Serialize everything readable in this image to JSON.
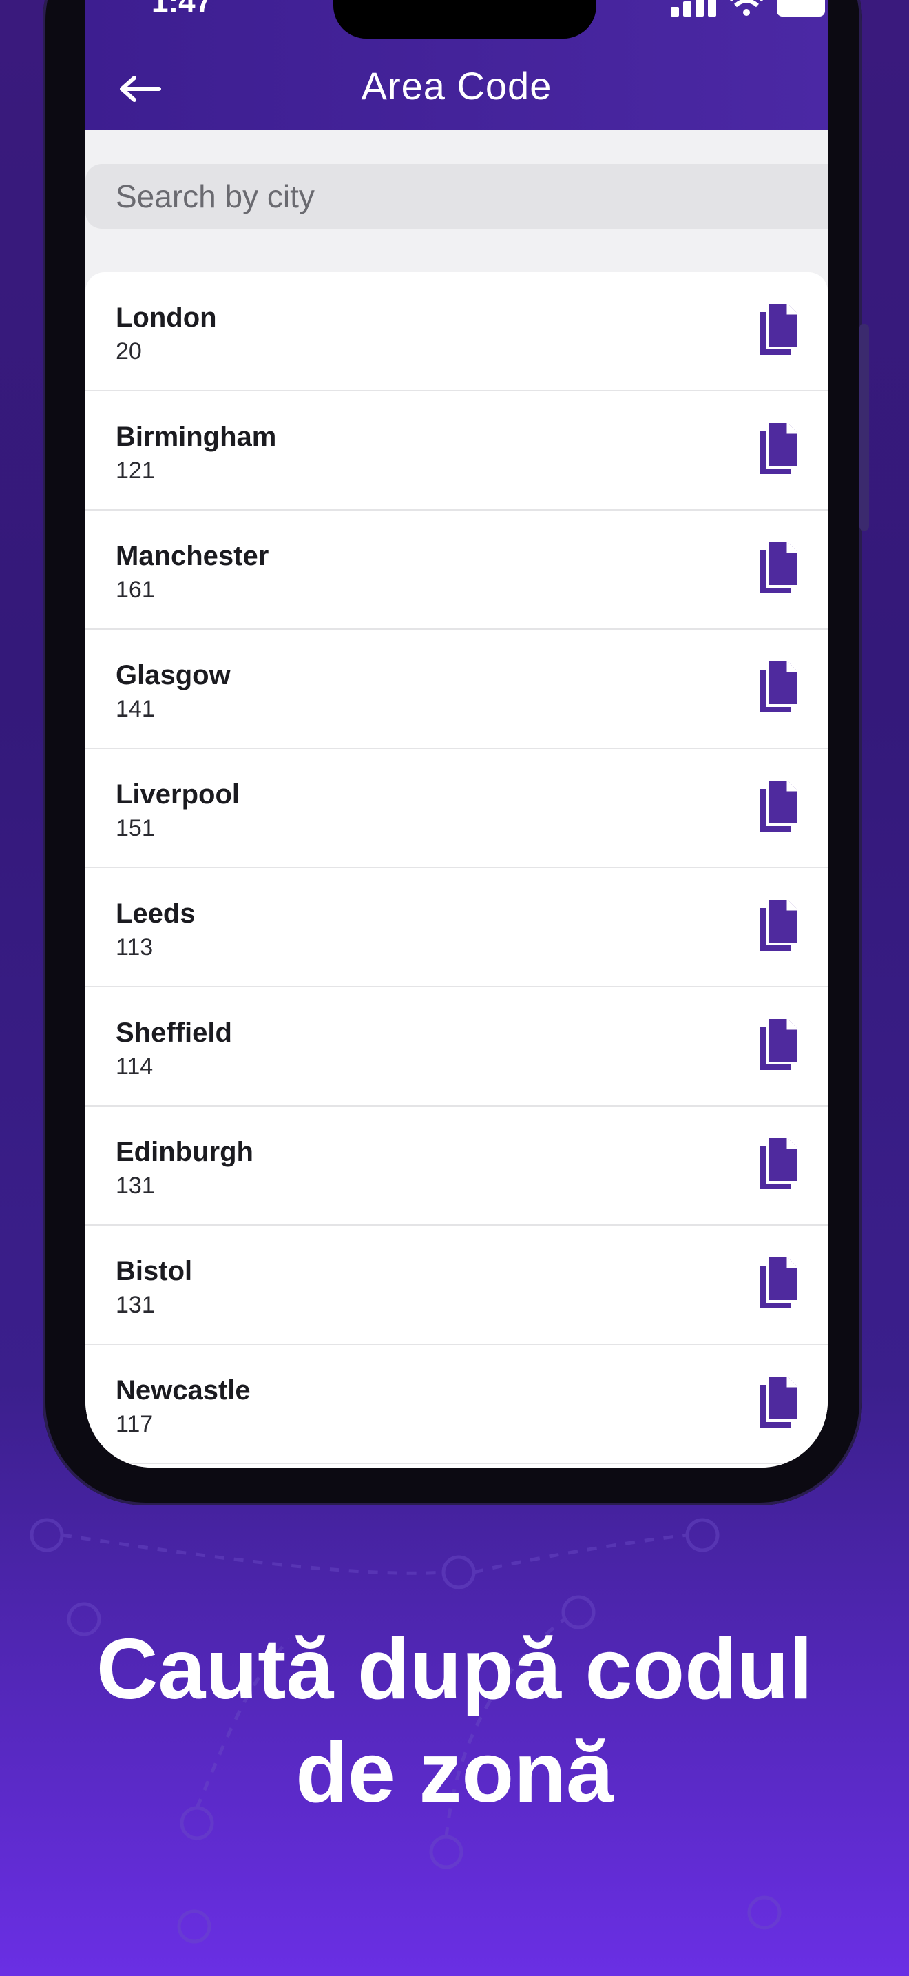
{
  "status_bar": {
    "time": "1:47"
  },
  "header": {
    "title": "Area Code",
    "back_icon": "arrow-left-icon"
  },
  "search": {
    "placeholder": "Search by city"
  },
  "rows": [
    {
      "city": "London",
      "code": "20"
    },
    {
      "city": "Birmingham",
      "code": "121"
    },
    {
      "city": "Manchester",
      "code": "161"
    },
    {
      "city": "Glasgow",
      "code": "141"
    },
    {
      "city": "Liverpool",
      "code": "151"
    },
    {
      "city": "Leeds",
      "code": "113"
    },
    {
      "city": "Sheffield",
      "code": "114"
    },
    {
      "city": "Edinburgh",
      "code": "131"
    },
    {
      "city": "Bistol",
      "code": "131"
    },
    {
      "city": "Newcastle",
      "code": "117"
    }
  ],
  "caption": {
    "line1": "Caută după codul",
    "line2": "de zonă"
  },
  "colors": {
    "accent": "#4b28a4",
    "icon": "#4f2a9e",
    "background": "#3a1a7d"
  }
}
